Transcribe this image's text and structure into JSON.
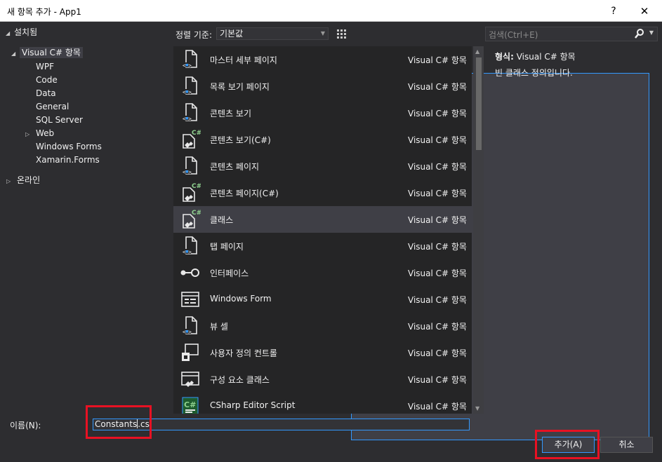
{
  "window": {
    "title": "새 항목 추가 - App1",
    "help_label": "?",
    "close_label": "✕"
  },
  "tree": {
    "installed": "설치됨",
    "visual_csharp": "Visual C# 항목",
    "children": [
      "WPF",
      "Code",
      "Data",
      "General",
      "SQL Server",
      "Web",
      "Windows Forms",
      "Xamarin.Forms"
    ],
    "online": "온라인"
  },
  "sort": {
    "label": "정렬 기준:",
    "value": "기본값"
  },
  "search": {
    "placeholder": "검색(Ctrl+E)"
  },
  "items": [
    {
      "name": "마스터 세부 페이지",
      "category": "Visual C# 항목",
      "icon": "xaml-page-icon"
    },
    {
      "name": "목록 보기 페이지",
      "category": "Visual C# 항목",
      "icon": "xaml-page-icon"
    },
    {
      "name": "콘텐츠 보기",
      "category": "Visual C# 항목",
      "icon": "xaml-page-icon"
    },
    {
      "name": "콘텐츠 보기(C#)",
      "category": "Visual C# 항목",
      "icon": "csharp-class-icon"
    },
    {
      "name": "콘텐츠 페이지",
      "category": "Visual C# 항목",
      "icon": "xaml-page-icon"
    },
    {
      "name": "콘텐츠 페이지(C#)",
      "category": "Visual C# 항목",
      "icon": "csharp-class-icon"
    },
    {
      "name": "클래스",
      "category": "Visual C# 항목",
      "icon": "csharp-class-icon"
    },
    {
      "name": "탭 페이지",
      "category": "Visual C# 항목",
      "icon": "xaml-page-icon"
    },
    {
      "name": "인터페이스",
      "category": "Visual C# 항목",
      "icon": "interface-icon"
    },
    {
      "name": "Windows Form",
      "category": "Visual C# 항목",
      "icon": "windows-form-icon"
    },
    {
      "name": "뷰 셀",
      "category": "Visual C# 항목",
      "icon": "xaml-page-icon"
    },
    {
      "name": "사용자 정의 컨트롤",
      "category": "Visual C# 항목",
      "icon": "user-control-icon"
    },
    {
      "name": "구성 요소 클래스",
      "category": "Visual C# 항목",
      "icon": "component-class-icon"
    },
    {
      "name": "CSharp Editor Script",
      "category": "Visual C# 항목",
      "icon": "csharp-script-icon"
    }
  ],
  "selected_index": 6,
  "details": {
    "type_label": "형식:",
    "type_value": "Visual C# 항목",
    "description": "빈 클래스 정의입니다."
  },
  "name_field": {
    "label": "이름(N):",
    "value": "Constants.cs"
  },
  "buttons": {
    "add": "추가(A)",
    "cancel": "취소"
  },
  "colors": {
    "background": "#2d2d30",
    "list_background": "#252526",
    "selection": "#3f3f46",
    "accent": "#3399ff",
    "annotation": "#e81123"
  }
}
